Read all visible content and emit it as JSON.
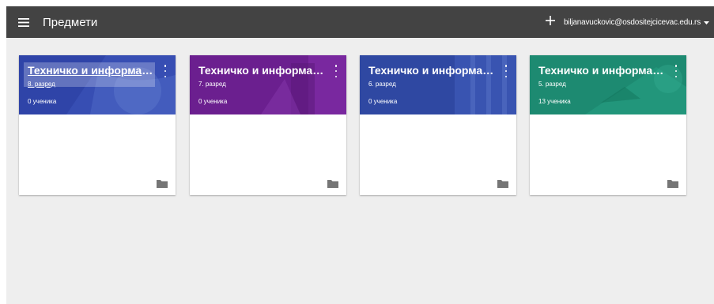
{
  "header": {
    "title": "Предмети",
    "account_email": "biljanavuckovic@osdositejcicevac.edu.rs",
    "menu_icon": "hamburger-menu-icon",
    "add_icon": "plus-icon",
    "account_caret_icon": "caret-down-icon"
  },
  "colors": {
    "topbar": "#434343",
    "background": "#eeeeee",
    "card1": "#2f44a8",
    "card2": "#6b1f8f",
    "card3": "#2f48a2",
    "card4": "#1d8a71"
  },
  "cards": [
    {
      "title": "Техничко и информати...",
      "grade": "8. разред",
      "students": "0 ученика",
      "color": "#2f44a8"
    },
    {
      "title": "Техничко и информати...",
      "grade": "7. разред",
      "students": "0 ученика",
      "color": "#6b1f8f"
    },
    {
      "title": "Техничко и информати...",
      "grade": "6. разред",
      "students": "0 ученика",
      "color": "#2f48a2"
    },
    {
      "title": "Техничко и информати...",
      "grade": "5. разред",
      "students": "13 ученика",
      "color": "#1d8a71"
    }
  ]
}
